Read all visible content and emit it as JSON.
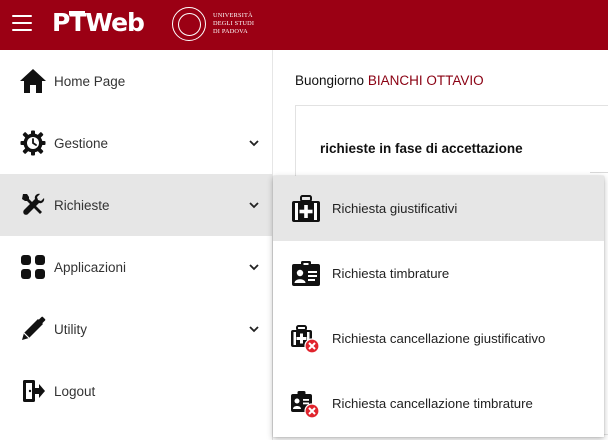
{
  "header": {
    "logo_prefix": "P",
    "logo_t": "T",
    "logo_suffix": "Web",
    "university_line1": "Università",
    "university_line2": "degli Studi",
    "university_line3": "di Padova",
    "background_color": "#9b0014"
  },
  "sidebar": {
    "items": [
      {
        "label": "Home Page",
        "icon": "home-icon",
        "has_submenu": false
      },
      {
        "label": "Gestione",
        "icon": "gear-clock-icon",
        "has_submenu": true
      },
      {
        "label": "Richieste",
        "icon": "tools-icon",
        "has_submenu": true,
        "active": true
      },
      {
        "label": "Applicazioni",
        "icon": "apps-grid-icon",
        "has_submenu": true
      },
      {
        "label": "Utility",
        "icon": "pencil-icon",
        "has_submenu": true
      },
      {
        "label": "Logout",
        "icon": "logout-icon",
        "has_submenu": false
      }
    ]
  },
  "main": {
    "greeting": "Buongiorno",
    "user_name": "BIANCHI OTTAVIO",
    "panel_title": "richieste in fase di accettazione"
  },
  "dropdown": {
    "items": [
      {
        "label": "Richiesta giustificativi",
        "icon": "medical-case-icon",
        "hovered": true
      },
      {
        "label": "Richiesta timbrature",
        "icon": "badge-icon"
      },
      {
        "label": "Richiesta cancellazione giustificativo",
        "icon": "medical-case-cancel-icon"
      },
      {
        "label": "Richiesta cancellazione timbrature",
        "icon": "badge-cancel-icon"
      }
    ]
  },
  "colors": {
    "brand_red": "#9b0014",
    "name_red": "#8a0012",
    "active_bg": "#e6e6e6",
    "cancel_red": "#e0242d"
  }
}
